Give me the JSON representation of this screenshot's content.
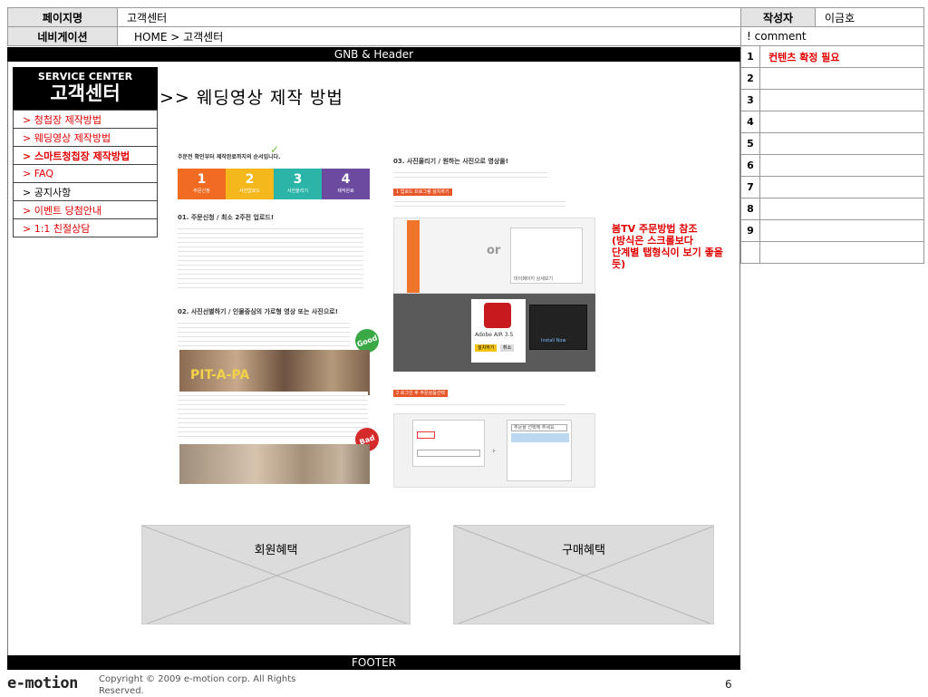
{
  "header": {
    "page_name_label": "페이지명",
    "page_name_value": "고객센터",
    "nav_label": "네비게이션",
    "nav_value": "HOME > 고객센터",
    "author_label": "작성자",
    "author_value": "이금호",
    "comment_label": "! comment"
  },
  "comments": [
    {
      "num": "1",
      "text": "컨텐츠 확정 필요"
    },
    {
      "num": "2",
      "text": ""
    },
    {
      "num": "3",
      "text": ""
    },
    {
      "num": "4",
      "text": ""
    },
    {
      "num": "5",
      "text": ""
    },
    {
      "num": "6",
      "text": ""
    },
    {
      "num": "7",
      "text": ""
    },
    {
      "num": "8",
      "text": ""
    },
    {
      "num": "9",
      "text": ""
    },
    {
      "num": "",
      "text": ""
    }
  ],
  "gnb_label": "GNB & Header",
  "footer_label": "FOOTER",
  "service_center": {
    "en": "SERVICE CENTER",
    "ko": "고객센터"
  },
  "page_heading": ">> 웨딩영상 제작 방법",
  "left_nav": [
    {
      "label": "> 청첩장 제작방법",
      "color": "#e00000",
      "bold": false
    },
    {
      "label": "> 웨딩영상 제작방법",
      "color": "#e00000",
      "bold": false
    },
    {
      "label": "> 스마트청첩장 제작방법",
      "color": "#e00000",
      "bold": true
    },
    {
      "label": "> FAQ",
      "color": "#e00000",
      "bold": false
    },
    {
      "label": "> 공지사항",
      "color": "#000000",
      "bold": false
    },
    {
      "label": "> 이벤트 당첨안내",
      "color": "#e00000",
      "bold": false
    },
    {
      "label": "> 1:1 친절상담",
      "color": "#e00000",
      "bold": false
    }
  ],
  "annotation": "봄TV 주문방법 참조\n(방식은 스크롤보다\n단계별 탭형식이 보기 좋을듯)",
  "content": {
    "steps": [
      {
        "num": "1",
        "label": "주문신청",
        "color": "#f26b22"
      },
      {
        "num": "2",
        "label": "사진업로드",
        "color": "#f5b81c"
      },
      {
        "num": "3",
        "label": "사진올리기",
        "color": "#2bb5a8"
      },
      {
        "num": "4",
        "label": "제작완료",
        "color": "#6b4aa0"
      }
    ],
    "left_heading": "주문전 확인부터 제작완료까지의 순서입니다.",
    "s01": "01. 주문신청 / 최소 2주전 업로드!",
    "s02": "02. 사진선별하기 / 인물중심의 가로형 영상 또는 사진으로!",
    "good": "Good",
    "bad": "Bad",
    "photo_text": "PIT-A-PA",
    "s03": "03. 사진올리기 / 원하는 사진으로 영상을!",
    "step1_tag": "1 업로드 프로그램 설치하기",
    "or": "or",
    "myinfo": "마이페이지 상세보기",
    "adobe_name": "Adobe AIR 3.5",
    "adobe_btn1": "설치하기",
    "adobe_btn2": "취소",
    "install_now": "Install Now",
    "step2_tag": "2 로그인 후 주문상품선택",
    "select_label": "주문을 선택해 주세요"
  },
  "benefits": {
    "member": "회원혜택",
    "purchase": "구매혜택"
  },
  "footer": {
    "logo": "e-motion",
    "copyright": "Copyright © 2009 e-motion corp. All Rights Reserved.",
    "page_num": "6"
  }
}
